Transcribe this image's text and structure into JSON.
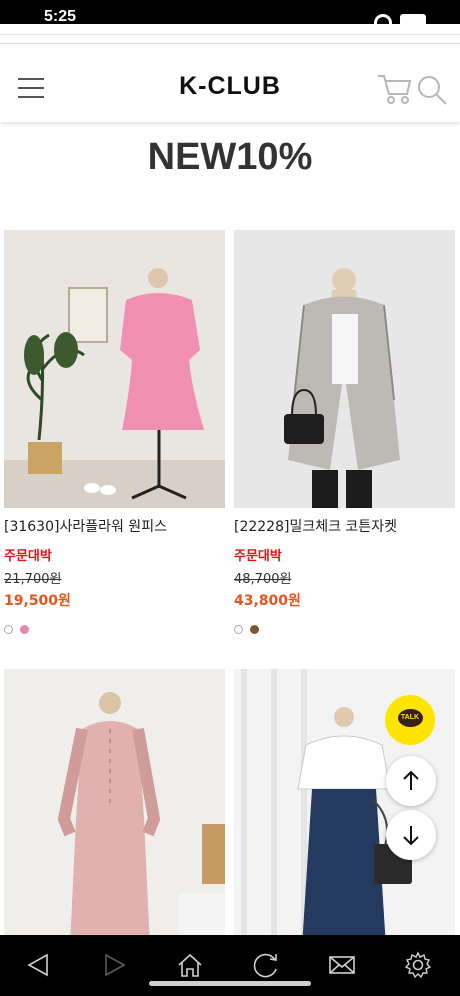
{
  "status_bar": {
    "time": "5:25"
  },
  "header": {
    "logo": "K-CLUB"
  },
  "section": {
    "title": "NEW10%"
  },
  "products": [
    {
      "name": "[31630]사라플라워 원피스",
      "badge": "주문대박",
      "original_price": "21,700원",
      "sale_price": "19,500원",
      "swatch_colors": [
        "#ffffff",
        "#e38aa4"
      ]
    },
    {
      "name": "[22228]밀크체크 코튼자켓",
      "badge": "주문대박",
      "original_price": "48,700원",
      "sale_price": "43,800원",
      "swatch_colors": [
        "#ffffff",
        "#7a5a2e"
      ]
    },
    {
      "name": "",
      "badge": "",
      "original_price": "",
      "sale_price": "",
      "swatch_colors": []
    },
    {
      "name": "",
      "badge": "",
      "original_price": "",
      "sale_price": "",
      "swatch_colors": []
    }
  ],
  "floating": {
    "talk_label": "TALK"
  },
  "colors": {
    "badge_red": "#e11414",
    "price_orange": "#e8541e",
    "kakao_yellow": "#fee500"
  },
  "icons": [
    "menu-icon",
    "cart-icon",
    "search-icon",
    "talk-icon",
    "arrow-up-icon",
    "arrow-down-icon",
    "back-icon",
    "forward-icon",
    "home-icon",
    "refresh-icon",
    "mail-icon",
    "settings-icon"
  ]
}
